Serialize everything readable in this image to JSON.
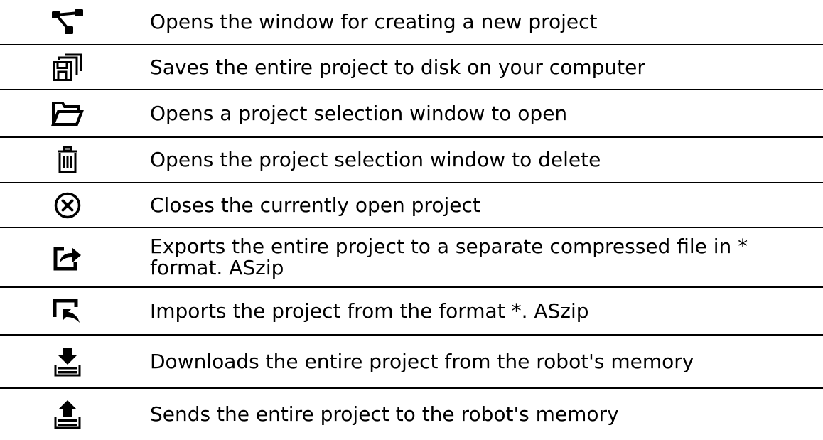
{
  "rows": [
    {
      "icon": "new-project-icon",
      "text": "Opens the window for creating a new project"
    },
    {
      "icon": "save-all-icon",
      "text": "Saves the entire project to disk on your computer"
    },
    {
      "icon": "folder-open-icon",
      "text": "Opens a project selection window to open"
    },
    {
      "icon": "trash-icon",
      "text": "Opens the project selection window to delete"
    },
    {
      "icon": "close-circle-icon",
      "text": "Closes the currently open project"
    },
    {
      "icon": "export-icon",
      "text": "Exports the entire project to a separate compressed file in * format. ASzip"
    },
    {
      "icon": "import-icon",
      "text": "Imports the project from the format *. ASzip"
    },
    {
      "icon": "download-icon",
      "text": "Downloads the entire project from the robot's memory"
    },
    {
      "icon": "upload-icon",
      "text": "Sends the entire project to the robot's memory"
    }
  ],
  "colors": {
    "text": "#000000",
    "icon": "#000000",
    "divider": "#000000",
    "background": "#ffffff"
  }
}
